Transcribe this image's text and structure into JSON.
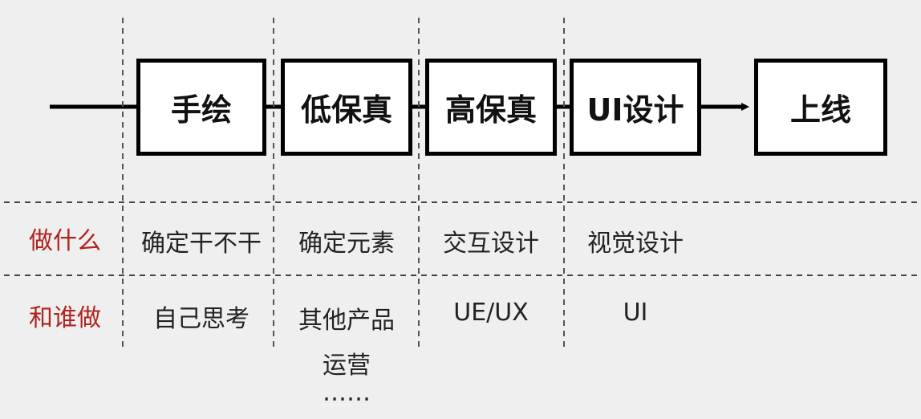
{
  "stages": [
    "手绘",
    "低保真",
    "高保真",
    "UI设计",
    "上线"
  ],
  "rows": [
    {
      "label": "做什么",
      "cells": [
        "确定干不干",
        "确定元素",
        "交互设计",
        "视觉设计"
      ]
    },
    {
      "label": "和谁做",
      "cells": [
        "自己思考",
        "其他产品",
        "UE/UX",
        "UI"
      ]
    }
  ],
  "extra_lines": [
    "运营",
    "……"
  ],
  "colors": {
    "background": "#efefef",
    "row_label": "#b0221f",
    "box_border": "#000000",
    "divider": "#333333"
  }
}
